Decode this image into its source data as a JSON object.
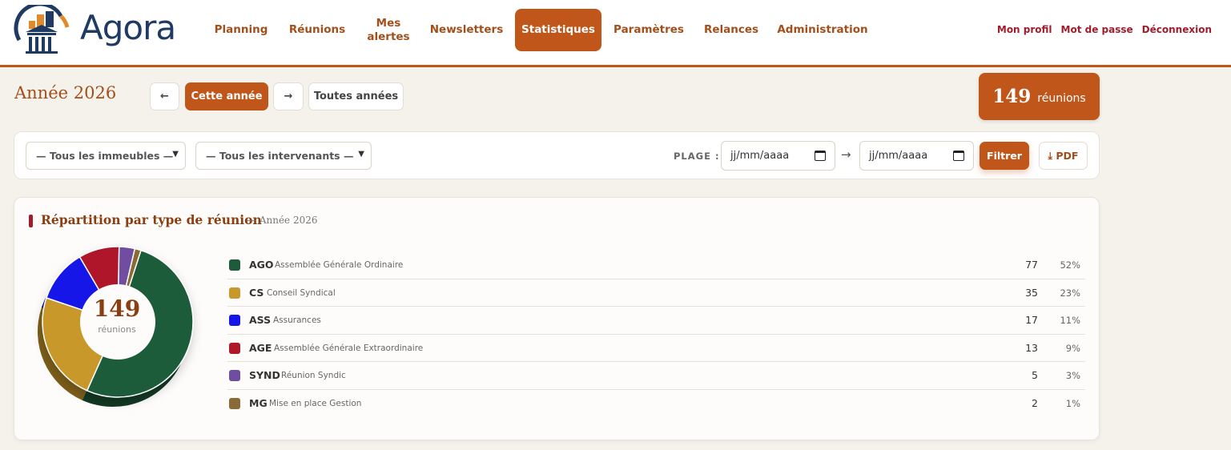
{
  "brand": {
    "name": "Agora"
  },
  "nav": {
    "items": [
      {
        "label": "Planning"
      },
      {
        "label": "Réunions"
      },
      {
        "label": "Mes alertes"
      },
      {
        "label": "Newsletters"
      },
      {
        "label": "Statistiques",
        "active": true
      },
      {
        "label": "Paramètres"
      },
      {
        "label": "Relances"
      },
      {
        "label": "Administration"
      }
    ]
  },
  "user_links": {
    "profile": "Mon profil",
    "password": "Mot de passe",
    "logout": "Déconnexion"
  },
  "year": {
    "title": "Année 2026",
    "prev": "←",
    "current": "Cette année",
    "next": "→",
    "all": "Toutes années"
  },
  "total": {
    "count": "149",
    "label": "réunions"
  },
  "filters": {
    "building": "— Tous les immeubles —",
    "speaker": "— Tous les intervenants —",
    "range_label": "PLAGE :",
    "date_from_placeholder": "jj/mm/aaaa",
    "date_to_placeholder": "jj/mm/aaaa",
    "separator": "→",
    "filter_button": "Filtrer",
    "pdf_button": "⤓ PDF"
  },
  "stats": {
    "title": "Répartition par type de réunion",
    "subtitle": "— Année 2026",
    "center_value": "149",
    "center_label": "réunions"
  },
  "chart_data": {
    "type": "pie",
    "categories": [
      "AGO",
      "CS",
      "ASS",
      "AGE",
      "SYND",
      "MG"
    ],
    "labels": [
      "Assemblée Générale Ordinaire",
      "Conseil Syndical",
      "Assurances",
      "Assemblée Générale Extraordinaire",
      "Réunion Syndic",
      "Mise en place Gestion"
    ],
    "values": [
      77,
      35,
      17,
      13,
      5,
      2
    ],
    "percentages": [
      "52%",
      "23%",
      "11%",
      "9%",
      "3%",
      "1%"
    ],
    "colors": [
      "#1e5b3a",
      "#c8982a",
      "#1515e8",
      "#b0182a",
      "#6f4ea0",
      "#8a6a36"
    ],
    "total": 149
  },
  "legend_rows": [
    {
      "code": "AGO",
      "label": "Assemblée Générale Ordinaire",
      "count": "77",
      "pct": "52%",
      "color": "#1e5b3a"
    },
    {
      "code": "CS",
      "label": "Conseil Syndical",
      "count": "35",
      "pct": "23%",
      "color": "#c8982a"
    },
    {
      "code": "ASS",
      "label": "Assurances",
      "count": "17",
      "pct": "11%",
      "color": "#1515e8"
    },
    {
      "code": "AGE",
      "label": "Assemblée Générale Extraordinaire",
      "count": "13",
      "pct": "9%",
      "color": "#b0182a"
    },
    {
      "code": "SYND",
      "label": "Réunion Syndic",
      "count": "5",
      "pct": "3%",
      "color": "#6f4ea0"
    },
    {
      "code": "MG",
      "label": "Mise en place Gestion",
      "count": "2",
      "pct": "1%",
      "color": "#8a6a36"
    }
  ],
  "colors": {
    "accent": "#c0561a",
    "accent_dark": "#a24f1b",
    "link_red": "#a31c2c",
    "background": "#f5f2ec"
  }
}
